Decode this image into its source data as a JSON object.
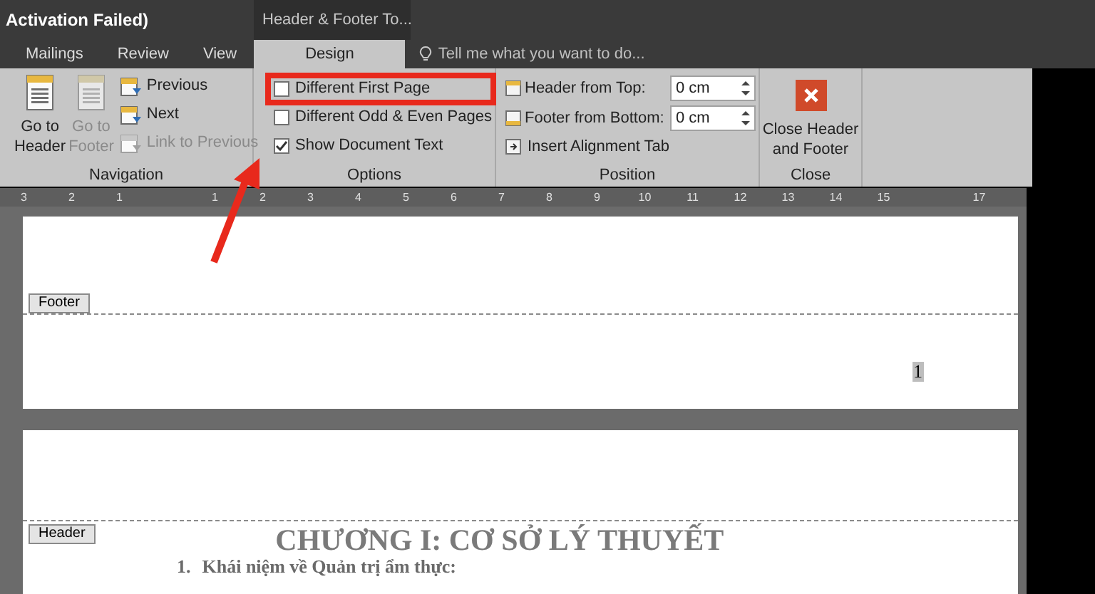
{
  "title_bar": {
    "title": "Activation Failed)",
    "context_tab": "Header & Footer To..."
  },
  "tabs": [
    {
      "label": "Mailings",
      "selected": false
    },
    {
      "label": "Review",
      "selected": false
    },
    {
      "label": "View",
      "selected": false
    },
    {
      "label": "Design",
      "selected": true
    }
  ],
  "tell_me": {
    "placeholder": "Tell me what you want to do..."
  },
  "navigation": {
    "label": "Navigation",
    "large_buttons": [
      {
        "label": "Go to Header",
        "disabled": false
      },
      {
        "label": "Go to Footer",
        "disabled": true
      }
    ],
    "small_buttons": [
      {
        "label": "Previous",
        "disabled": false
      },
      {
        "label": "Next",
        "disabled": false
      },
      {
        "label": "Link to Previous",
        "disabled": true
      }
    ]
  },
  "options": {
    "label": "Options",
    "checkboxes": [
      {
        "label": "Different First Page",
        "checked": false
      },
      {
        "label": "Different Odd & Even Pages",
        "checked": false
      },
      {
        "label": "Show Document Text",
        "checked": true
      }
    ]
  },
  "position": {
    "label": "Position",
    "fields": [
      {
        "label": "Header from Top:",
        "value": "0 cm"
      },
      {
        "label": "Footer from Bottom:",
        "value": "0 cm"
      }
    ],
    "button": "Insert Alignment Tab"
  },
  "close": {
    "label": "Close",
    "button": "Close Header and Footer"
  },
  "ruler": {
    "labels": [
      "3",
      "2",
      "1",
      "1",
      "2",
      "3",
      "4",
      "5",
      "6",
      "7",
      "8",
      "9",
      "10",
      "11",
      "12",
      "13",
      "14",
      "15",
      "17"
    ]
  },
  "pages": [
    {
      "tag": "Footer",
      "page_number": "1"
    },
    {
      "tag": "Header",
      "heading": "CHƯƠNG I: CƠ SỞ LÝ THUYẾT",
      "list_number": "1.",
      "list_item": "Khái niệm về Quản trị ẩm thực:"
    }
  ]
}
